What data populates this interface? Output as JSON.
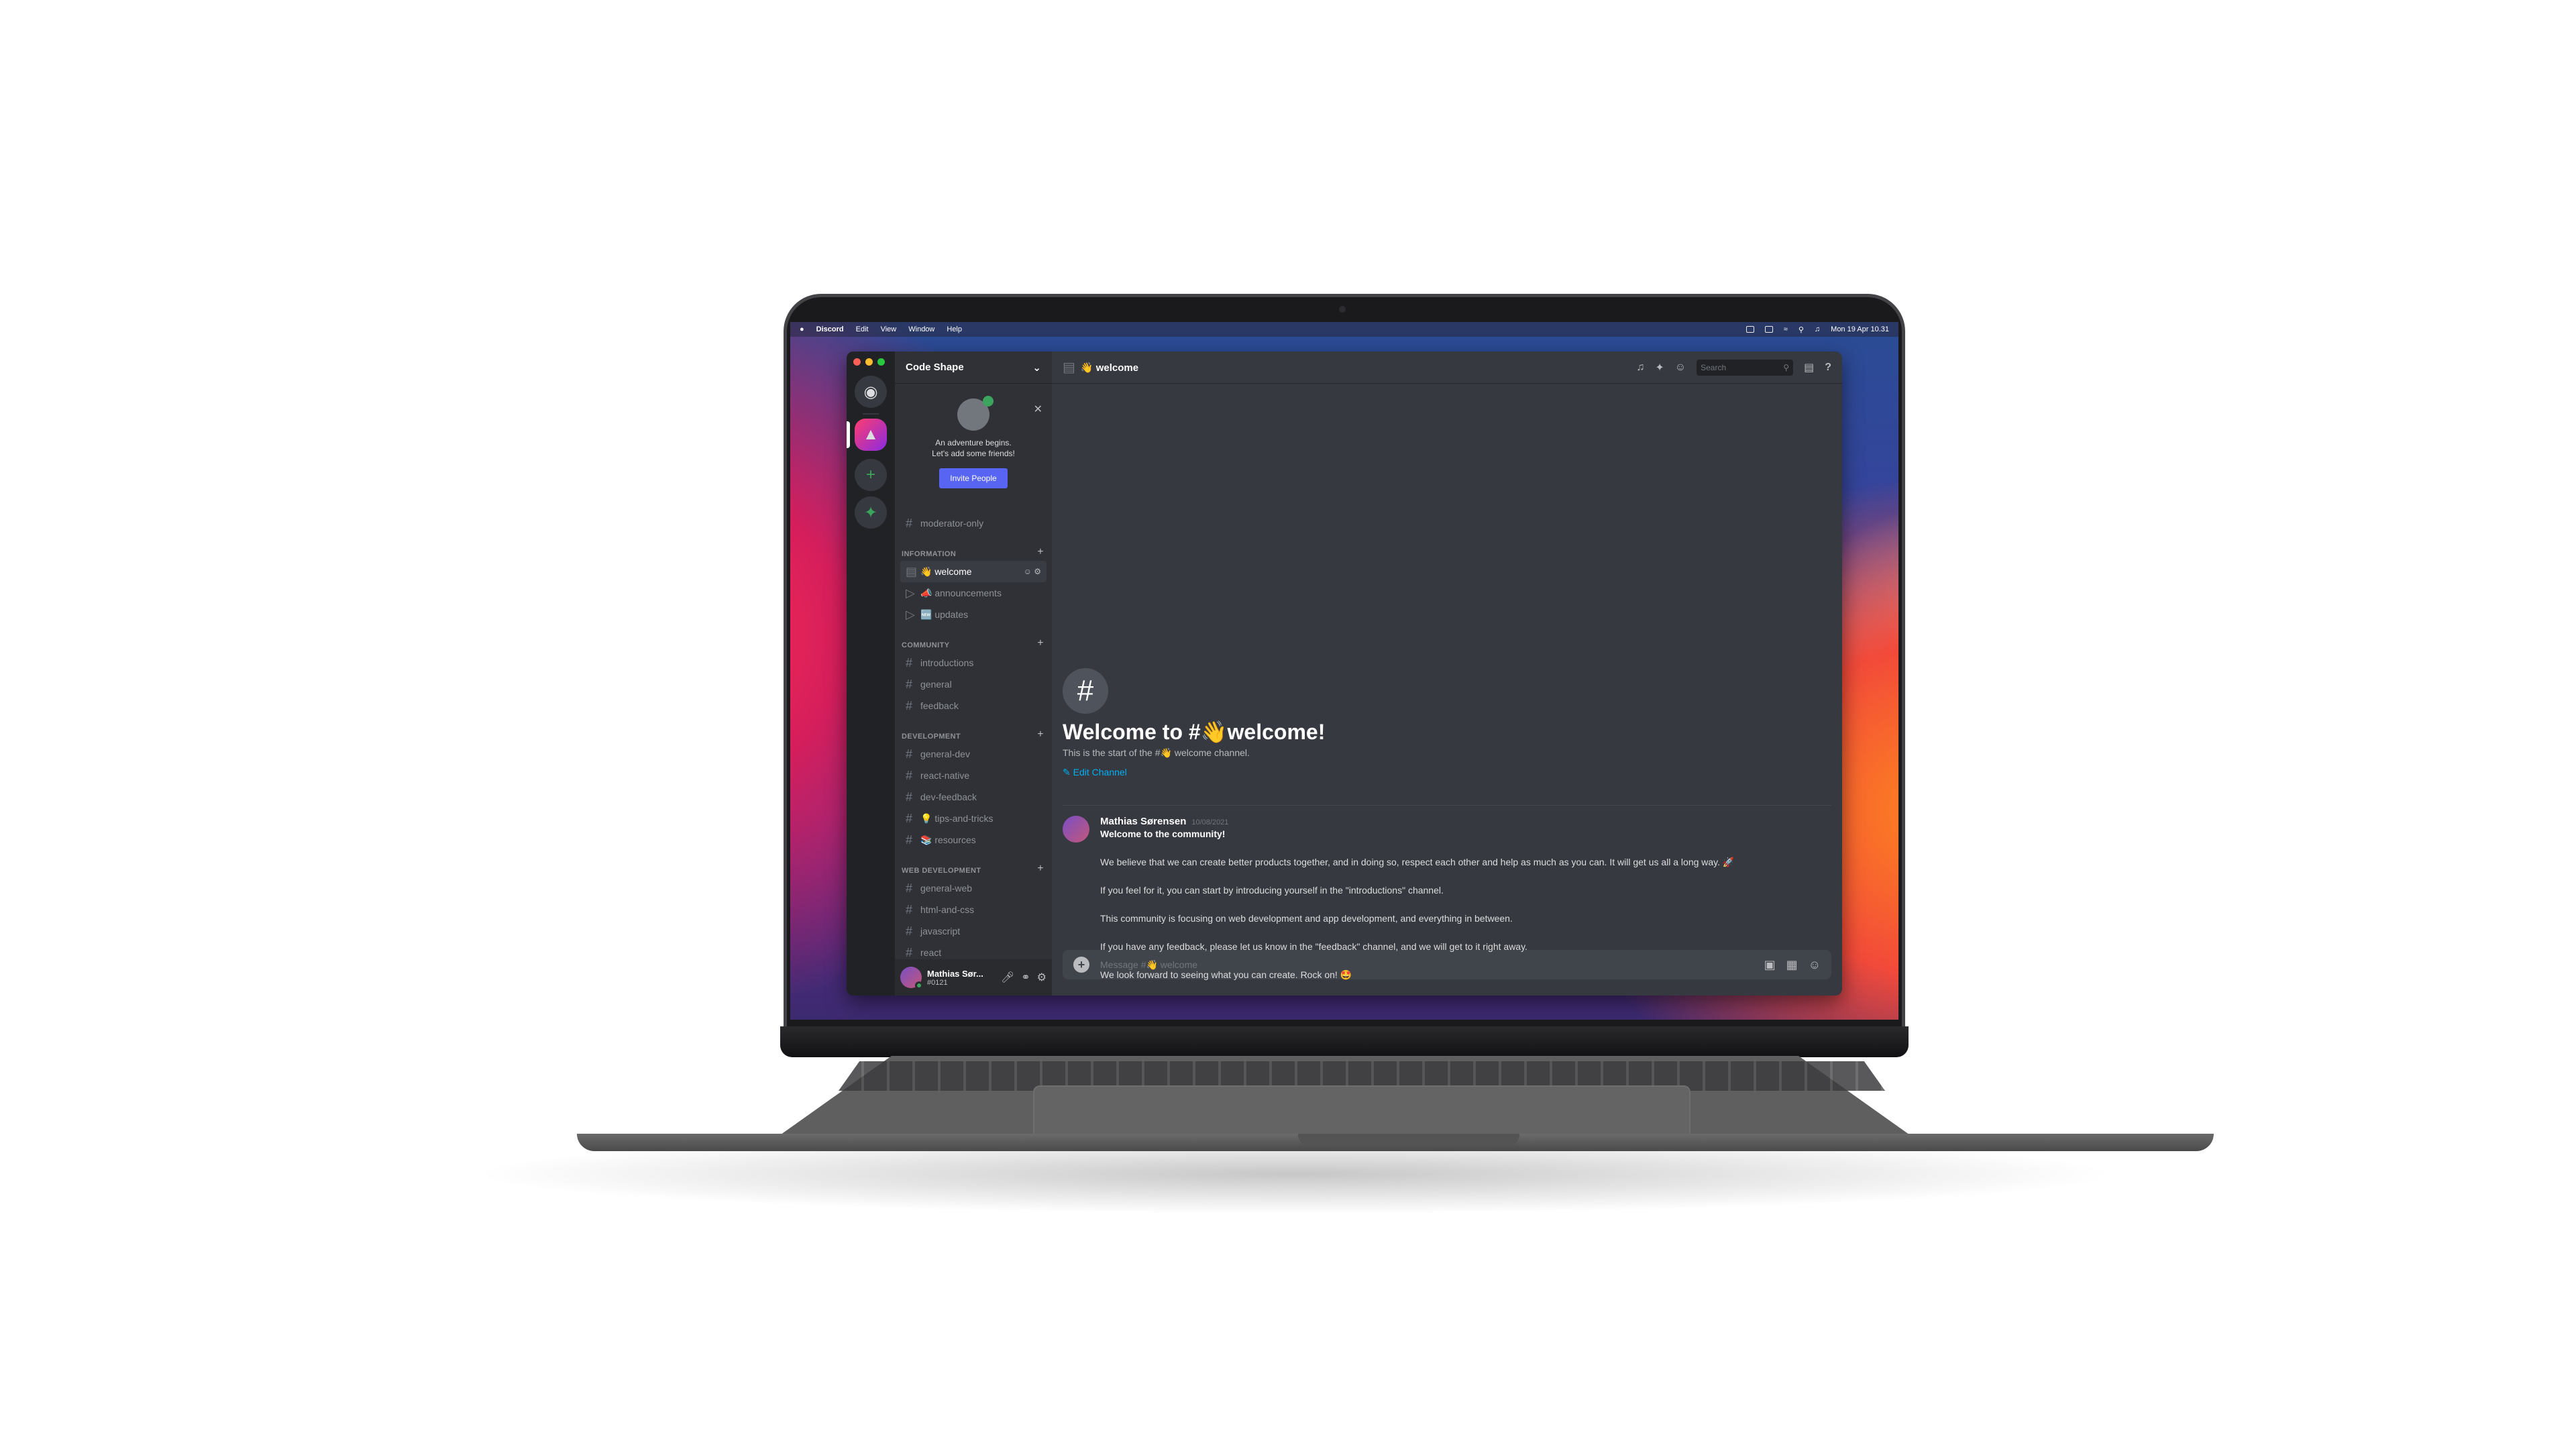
{
  "menubar": {
    "apple": "",
    "app": "Discord",
    "items": [
      "Edit",
      "View",
      "Window",
      "Help"
    ],
    "clock": "Mon 19 Apr  10.31"
  },
  "server": {
    "name": "Code Shape"
  },
  "invite": {
    "line1": "An adventure begins.",
    "line2": "Let's add some friends!",
    "button": "Invite People"
  },
  "channels": {
    "top": [
      {
        "name": "moderator-only"
      }
    ],
    "categories": [
      {
        "name": "INFORMATION",
        "channels": [
          "👋 welcome",
          "📣 announcements",
          "🆕 updates"
        ]
      },
      {
        "name": "COMMUNITY",
        "channels": [
          "introductions",
          "general",
          "feedback"
        ]
      },
      {
        "name": "DEVELOPMENT",
        "channels": [
          "general-dev",
          "react-native",
          "dev-feedback",
          "💡 tips-and-tricks",
          "📚 resources"
        ]
      },
      {
        "name": "WEB DEVELOPMENT",
        "channels": [
          "general-web",
          "html-and-css",
          "javascript",
          "react"
        ]
      }
    ]
  },
  "user": {
    "name": "Mathias Sør...",
    "tag": "#0121"
  },
  "topbar": {
    "channel": "👋 welcome",
    "search_placeholder": "Search"
  },
  "welcome": {
    "title": "Welcome to #👋welcome!",
    "subtitle": "This is the start of the #👋 welcome channel.",
    "edit": "Edit Channel"
  },
  "message": {
    "author": "Mathias Sørensen",
    "time": "10/08/2021",
    "lines": [
      "Welcome to the community!",
      "We believe that we can create better products together, and in doing so, respect each other and help as much as you can. It will get us all a long way. 🚀",
      "If you feel for it, you can start by introducing yourself in the \"introductions\" channel.",
      "This community is focusing on web development and app development, and everything in between.",
      "If you have any feedback, please let us know in the \"feedback\" channel, and we will get to it right away.",
      "We look forward to seeing what you can create. Rock on! 🤩"
    ]
  },
  "composer": {
    "placeholder": "Message #👋 welcome"
  },
  "colors": {
    "accent": "#5865f2",
    "online": "#3ba55d",
    "link": "#00aff4"
  }
}
